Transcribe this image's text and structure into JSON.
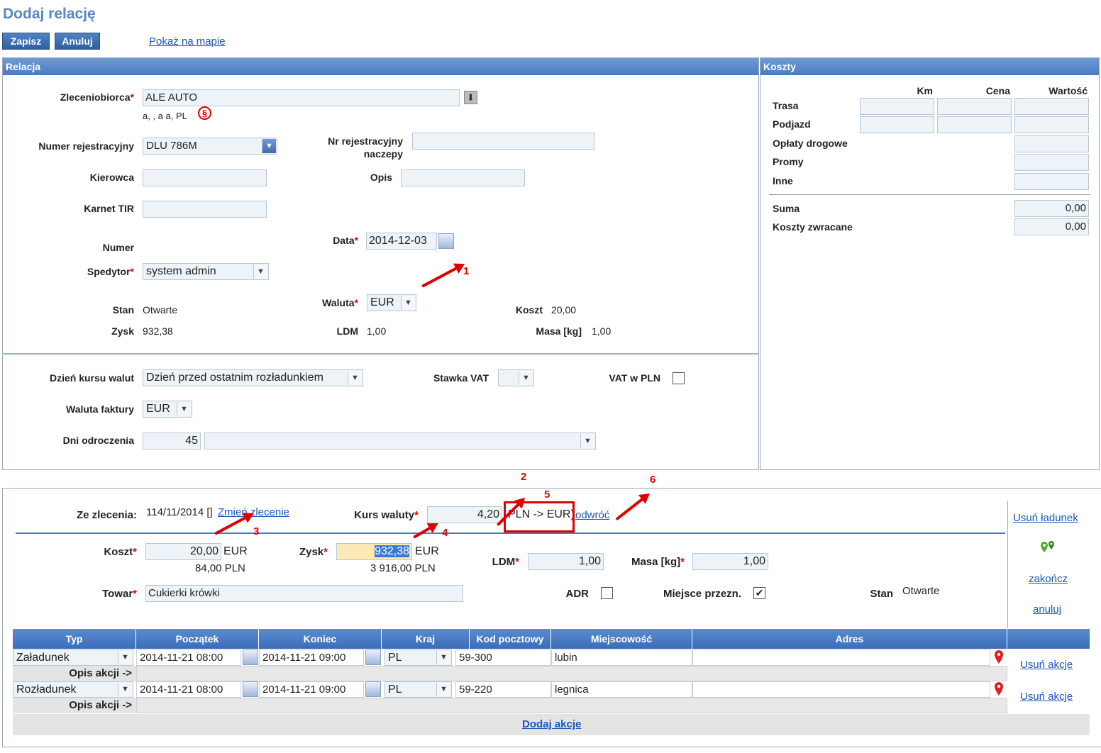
{
  "page": {
    "title": "Dodaj relację"
  },
  "toolbar": {
    "save_label": "Zapisz",
    "cancel_label": "Anuluj",
    "map_link": "Pokaż na mapie"
  },
  "relacja": {
    "header": "Relacja",
    "zleceniobiorca_label": "Zleceniobiorca",
    "zleceniobiorca_value": "ALE AUTO",
    "zleceniobiorca_address": "a, , a a, PL",
    "nr_rej_label": "Numer rejestracyjny",
    "nr_rej_value": "DLU 786M",
    "nr_rej_naczepy_label_1": "Nr rejestracyjny",
    "nr_rej_naczepy_label_2": "naczepy",
    "nr_rej_naczepy_value": "",
    "kierowca_label": "Kierowca",
    "kierowca_value": "",
    "opis_label": "Opis",
    "opis_value": "",
    "karnet_label": "Karnet TIR",
    "karnet_value": "",
    "numer_label": "Numer",
    "data_label": "Data",
    "data_value": "2014-12-03",
    "spedytor_label": "Spedytor",
    "spedytor_value": "system admin",
    "waluta_label": "Waluta",
    "waluta_value": "EUR",
    "stan_label": "Stan",
    "stan_value": "Otwarte",
    "koszt_label": "Koszt",
    "koszt_value": "20,00",
    "zysk_label": "Zysk",
    "zysk_value": "932,38",
    "ldm_label": "LDM",
    "ldm_value": "1,00",
    "masa_label": "Masa [kg]",
    "masa_value": "1,00"
  },
  "faktura": {
    "dzien_label": "Dzień kursu walut",
    "dzien_value": "Dzień przed ostatnim rozładunkiem",
    "vat_label": "Stawka VAT",
    "vat_value": "",
    "vat_pln_label": "VAT w PLN",
    "waluta_faktury_label": "Waluta faktury",
    "waluta_faktury_value": "EUR",
    "dni_label": "Dni odroczenia",
    "dni_value": "45",
    "dni_select_value": ""
  },
  "koszty": {
    "header": "Koszty",
    "col_km": "Km",
    "col_cena": "Cena",
    "col_wartosc": "Wartość",
    "rows": [
      "Trasa",
      "Podjazd",
      "Opłaty drogowe",
      "Promy",
      "Inne"
    ],
    "suma_label": "Suma",
    "suma_value": "0,00",
    "zwracane_label": "Koszty zwracane",
    "zwracane_value": "0,00"
  },
  "ladunek": {
    "ze_zlecenia_label": "Ze zlecenia:",
    "ze_zlecenia_value": "114/11/2014 []",
    "zmien_link": "Zmień zlecenie",
    "kurs_label": "Kurs waluty",
    "kurs_value": "4,20",
    "kurs_direction": "PLN -> EUR)",
    "odwroc_link": "odwróć",
    "koszt_label": "Koszt",
    "koszt_value": "20,00",
    "koszt_currency": "EUR",
    "koszt_pln": "84,00 PLN",
    "zysk_label": "Zysk",
    "zysk_value": "932,38",
    "zysk_currency": "EUR",
    "zysk_pln": "3 916,00 PLN",
    "ldm_label": "LDM",
    "ldm_value": "1,00",
    "masa_label": "Masa [kg]",
    "masa_value": "1,00",
    "towar_label": "Towar",
    "towar_value": "Cukierki krówki",
    "adr_label": "ADR",
    "miejsce_label": "Miejsce przezn.",
    "stan_label": "Stan",
    "stan_value": "Otwarte",
    "usun_ladunek": "Usuń ładunek",
    "zakoncz": "zakończ",
    "anuluj": "anuluj"
  },
  "actions_table": {
    "headers": [
      "Typ",
      "Początek",
      "Koniec",
      "Kraj",
      "Kod pocztowy",
      "Miejscowość",
      "Adres"
    ],
    "rows": [
      {
        "typ": "Załadunek",
        "poczatek": "2014-11-21 08:00",
        "koniec": "2014-11-21 09:00",
        "kraj": "PL",
        "kod": "59-300",
        "miejscowosc": "lubin",
        "adres": "",
        "opis_label": "Opis akcji ->",
        "delete": "Usuń akcje"
      },
      {
        "typ": "Rozładunek",
        "poczatek": "2014-11-21 08:00",
        "koniec": "2014-11-21 09:00",
        "kraj": "PL",
        "kod": "59-220",
        "miejscowosc": "legnica",
        "adres": "",
        "opis_label": "Opis akcji ->",
        "delete": "Usuń akcje"
      }
    ],
    "add_link": "Dodaj akcje"
  },
  "annotations": [
    "1",
    "2",
    "3",
    "4",
    "5",
    "6"
  ],
  "colors": {
    "accent": "#4a7bbf",
    "annotation": "#e00000",
    "highlight": "#fde9b8"
  }
}
